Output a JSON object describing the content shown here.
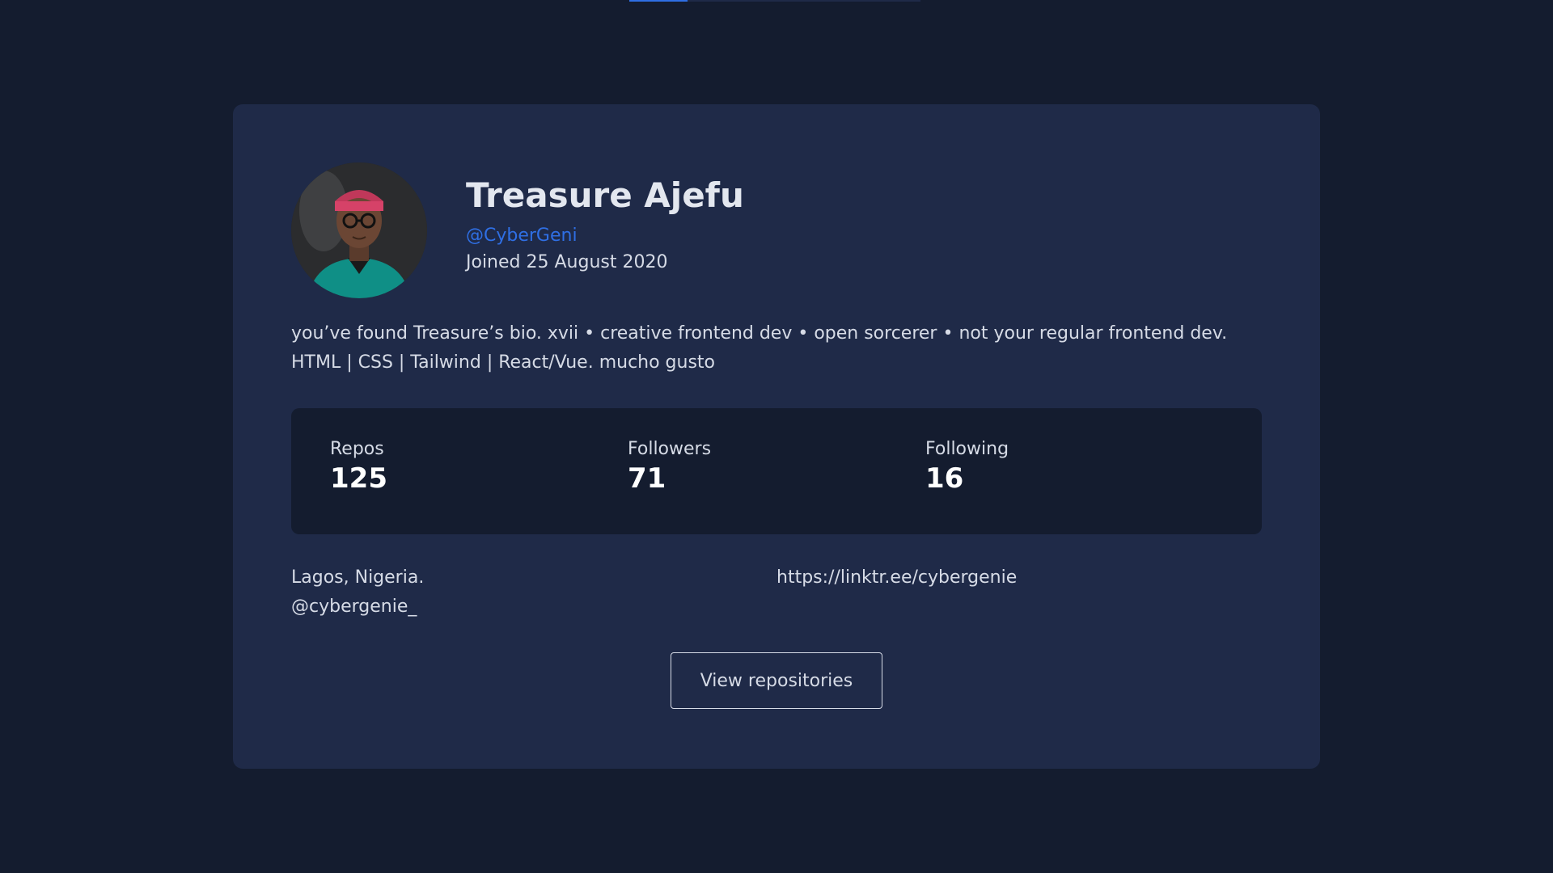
{
  "profile": {
    "name": "Treasure Ajefu",
    "handle": "@CyberGeni",
    "joined": "Joined 25 August 2020",
    "bio_line1": "you’ve found Treasure’s bio. xvii • creative frontend dev • open sorcerer • not your regular frontend dev.",
    "bio_line2": "HTML | CSS | Tailwind | React/Vue. mucho gusto",
    "avatar_icon": "user-avatar"
  },
  "stats": [
    {
      "label": "Repos",
      "value": "125"
    },
    {
      "label": "Followers",
      "value": "71"
    },
    {
      "label": "Following",
      "value": "16"
    }
  ],
  "links": {
    "location": "Lagos, Nigeria.",
    "twitter": "@cybergenie_",
    "website": "https://linktr.ee/cybergenie"
  },
  "actions": {
    "view_repos_label": "View repositories"
  },
  "colors": {
    "background": "#141c2f",
    "card": "#1f2a48",
    "accent": "#2f6fe4",
    "text": "#d6dbe6"
  }
}
